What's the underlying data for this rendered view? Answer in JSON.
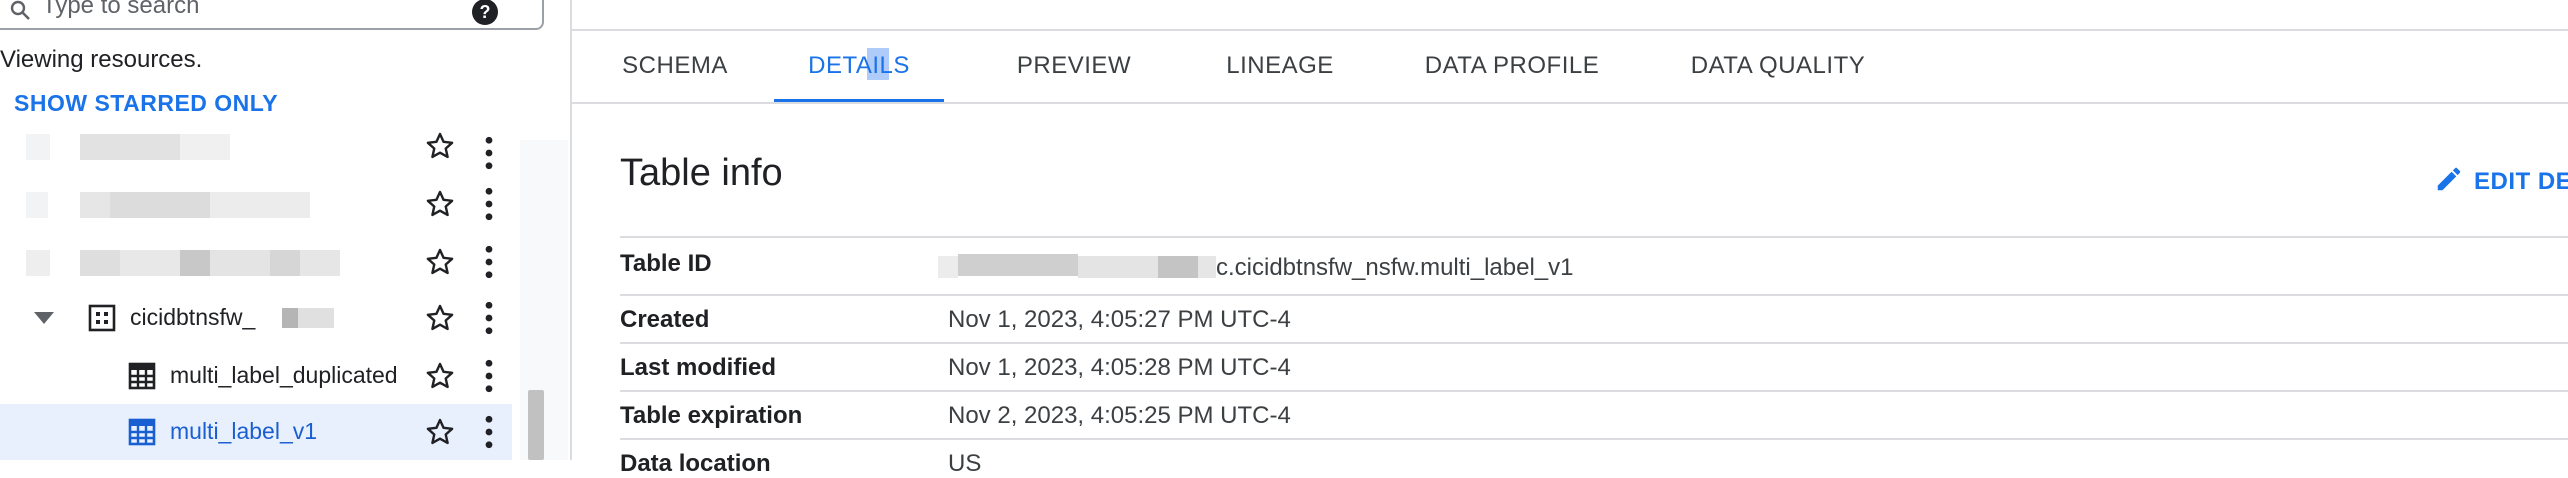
{
  "explorer": {
    "search": {
      "placeholder": "Type to search"
    },
    "viewing_text": "Viewing resources.",
    "show_starred_label": "SHOW STARRED ONLY",
    "dataset": {
      "name": "cicidbtnsfw_"
    },
    "tables": [
      {
        "name": "multi_label_duplicated",
        "selected": false
      },
      {
        "name": "multi_label_v1",
        "selected": true
      }
    ]
  },
  "tabs": [
    {
      "label": "SCHEMA",
      "active": false
    },
    {
      "label": "DETAILS",
      "active": true
    },
    {
      "label": "PREVIEW",
      "active": false
    },
    {
      "label": "LINEAGE",
      "active": false
    },
    {
      "label": "DATA PROFILE",
      "active": false
    },
    {
      "label": "DATA QUALITY",
      "active": false
    }
  ],
  "table_info": {
    "title": "Table info",
    "edit_label": "EDIT DE",
    "rows": [
      {
        "label": "Table ID",
        "value": "c.cicidbtnsfw_nsfw.multi_label_v1"
      },
      {
        "label": "Created",
        "value": "Nov 1, 2023, 4:05:27 PM UTC-4"
      },
      {
        "label": "Last modified",
        "value": "Nov 1, 2023, 4:05:28 PM UTC-4"
      },
      {
        "label": "Table expiration",
        "value": "Nov 2, 2023, 4:05:25 PM UTC-4"
      },
      {
        "label": "Data location",
        "value": "US"
      }
    ]
  },
  "colors": {
    "accent": "#1a73e8",
    "selected_row_bg": "#e8f0fe",
    "divider": "#dadce0"
  }
}
